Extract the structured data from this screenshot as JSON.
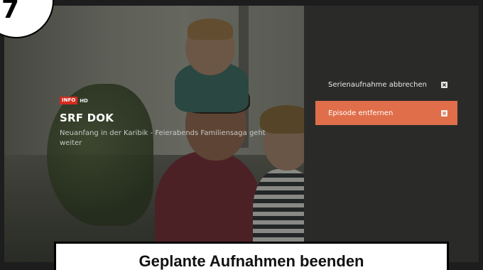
{
  "step_badge": {
    "number": "7"
  },
  "channel": {
    "logo_text": "INFO",
    "hd_label": "HD",
    "logo_color": "#d42b20"
  },
  "program": {
    "title": "SRF DOK",
    "subtitle": "Neuanfang in der Karibik - Feierabends Familiensaga geht weiter"
  },
  "menu": {
    "items": [
      {
        "label": "Serienaufnahme abbrechen",
        "icon": "close-square-icon",
        "selected": false
      },
      {
        "label": "Episode entfernen",
        "icon": "close-square-icon",
        "selected": true
      }
    ],
    "accent_color": "#e06e4a"
  },
  "caption": {
    "text": "Geplante Aufnahmen beenden"
  }
}
